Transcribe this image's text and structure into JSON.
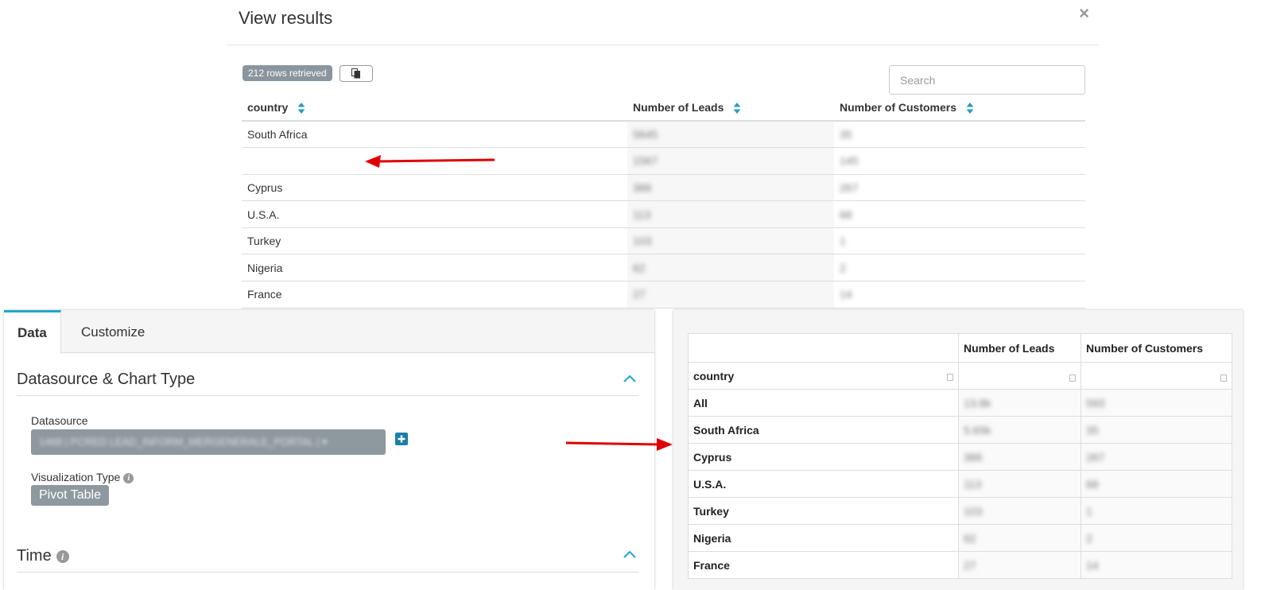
{
  "modal": {
    "title": "View results",
    "close_label": "×",
    "rows_badge": "212 rows retrieved",
    "search_placeholder": "Search",
    "columns": [
      "country",
      "Number of Leads",
      "Number of Customers"
    ],
    "rows": [
      {
        "country": "South Africa",
        "leads": "5645",
        "customers": "35"
      },
      {
        "country": "",
        "leads": "1567",
        "customers": "145"
      },
      {
        "country": "Cyprus",
        "leads": "386",
        "customers": "267"
      },
      {
        "country": "U.S.A.",
        "leads": "113",
        "customers": "68"
      },
      {
        "country": "Turkey",
        "leads": "103",
        "customers": "1"
      },
      {
        "country": "Nigeria",
        "leads": "62",
        "customers": "2"
      },
      {
        "country": "France",
        "leads": "27",
        "customers": "14"
      }
    ]
  },
  "left_panel": {
    "tabs": [
      "Data",
      "Customize"
    ],
    "active_tab": "Data",
    "section_datasource": "Datasource & Chart Type",
    "datasource_label": "Datasource",
    "datasource_value": "1468 | PCRED LEAD_INFORM_MERGENERALE_PORTAL | ▾",
    "viz_label": "Visualization Type",
    "viz_value": "Pivot Table",
    "section_time": "Time"
  },
  "pivot": {
    "header_leads": "Number of Leads",
    "header_customers": "Number of Customers",
    "row_header": "country",
    "rows": [
      {
        "country": "All",
        "leads": "13.8k",
        "customers": "593"
      },
      {
        "country": "South Africa",
        "leads": "5.65k",
        "customers": "35"
      },
      {
        "country": "Cyprus",
        "leads": "386",
        "customers": "267"
      },
      {
        "country": "U.S.A.",
        "leads": "113",
        "customers": "68"
      },
      {
        "country": "Turkey",
        "leads": "103",
        "customers": "1"
      },
      {
        "country": "Nigeria",
        "leads": "62",
        "customers": "2"
      },
      {
        "country": "France",
        "leads": "27",
        "customers": "14"
      }
    ]
  },
  "colors": {
    "accent": "#20a7c9",
    "badge": "#8a959d",
    "arrow": "#e00000",
    "plus": "#1a7fa8"
  }
}
